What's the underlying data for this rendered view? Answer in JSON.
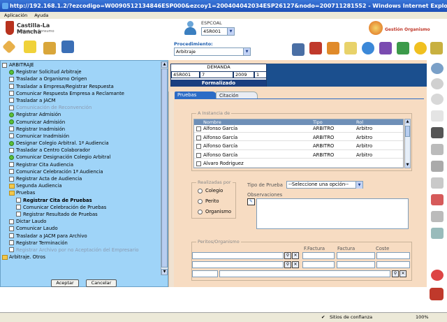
{
  "window": {
    "title": "http://192.168.1.2/?ezcodigo=W0090512134846ESP000&ezcoy1=200404042034ESP26127&nodo=200711281552 - Windows Internet Explorer"
  },
  "menubar": {
    "items": [
      "Aplicación",
      "Ayuda"
    ]
  },
  "header": {
    "logo_name": "Castilla-La Mancha",
    "logo_sub": "Instituto de Consumo",
    "espcoal_label": "ESPCOAL",
    "espcoal_value": "45R001",
    "gestion_label": "Gestión Organismo",
    "procedimiento_label": "Procedimiento:",
    "procedimiento_value": "Arbitraje"
  },
  "tree": {
    "items": [
      {
        "label": "ARBITRAJE",
        "icon": "minus-icon",
        "indent": 0
      },
      {
        "label": "Registrar Solicitud Arbitraje",
        "icon": "done-icon",
        "indent": 1
      },
      {
        "label": "Trasladar a Organismo Origen",
        "icon": "checkbox-icon",
        "indent": 1
      },
      {
        "label": "Trasladar a Empresa/Registrar Respuesta",
        "icon": "checkbox-icon",
        "indent": 1
      },
      {
        "label": "Comunicar Respuesta Empresa a Reclamante",
        "icon": "checkbox-icon",
        "indent": 1
      },
      {
        "label": "Trasladar a JACM",
        "icon": "checkbox-icon",
        "indent": 1
      },
      {
        "label": "Comunicación de Reconvención",
        "icon": "checkbox-icon",
        "indent": 1,
        "muted": true
      },
      {
        "label": "Registrar Admisión",
        "icon": "done-icon",
        "indent": 1
      },
      {
        "label": "Comunicar Admisión",
        "icon": "done-icon",
        "indent": 1
      },
      {
        "label": "Registrar Inadmisión",
        "icon": "checkbox-icon",
        "indent": 1
      },
      {
        "label": "Comunicar Inadmisión",
        "icon": "checkbox-icon",
        "indent": 1
      },
      {
        "label": "Designar Colegio Arbitral. 1ª Audiencia",
        "icon": "done-icon",
        "indent": 1
      },
      {
        "label": "Trasladar a Centro Colaborador",
        "icon": "checkbox-icon",
        "indent": 1
      },
      {
        "label": "Comunicar Designación Colegio Arbitral",
        "icon": "done-icon",
        "indent": 1
      },
      {
        "label": "Registrar Cita Audiencia",
        "icon": "checkbox-icon",
        "indent": 1
      },
      {
        "label": "Comunicar Celebración 1ª Audiencia",
        "icon": "checkbox-icon",
        "indent": 1
      },
      {
        "label": "Registrar Acta de Audiencia",
        "icon": "checkbox-icon",
        "indent": 1
      },
      {
        "label": "Segunda Audiencia",
        "icon": "folder-icon",
        "indent": 1
      },
      {
        "label": "Pruebas",
        "icon": "folder-icon",
        "indent": 1
      },
      {
        "label": "Registrar Cita de Pruebas",
        "icon": "checkbox-icon",
        "indent": 2,
        "bold": true
      },
      {
        "label": "Comunicar Celebración de Pruebas",
        "icon": "checkbox-icon",
        "indent": 2
      },
      {
        "label": "Registrar Resultado de Pruebas",
        "icon": "checkbox-icon",
        "indent": 2
      },
      {
        "label": "Dictar Laudo",
        "icon": "checkbox-icon",
        "indent": 1
      },
      {
        "label": "Comunicar Laudo",
        "icon": "checkbox-icon",
        "indent": 1
      },
      {
        "label": "Trasladar a JACM para Archivo",
        "icon": "checkbox-icon",
        "indent": 1
      },
      {
        "label": "Registrar Terminación",
        "icon": "checkbox-icon",
        "indent": 1
      },
      {
        "label": "Registrar Archivo por no Aceptación del Empresario",
        "icon": "checkbox-icon",
        "indent": 1,
        "muted": true
      },
      {
        "label": "Arbitraje. Otros",
        "icon": "folder-icon",
        "indent": 0
      }
    ],
    "accept_label": "Aceptar",
    "cancel_label": "Cancelar"
  },
  "demanda": {
    "title": "DEMANDA",
    "cells": [
      "45R001",
      "7",
      "2009",
      "1"
    ],
    "status": "Formalizado"
  },
  "tabs": [
    {
      "label": "Pruebas",
      "active": true
    },
    {
      "label": "Citación",
      "active": false
    }
  ],
  "instancia": {
    "legend": "A Instancia de",
    "columns": [
      "Nombre",
      "Tipo",
      "Rol"
    ],
    "rows": [
      [
        "Alfonso García",
        "ARBITRO",
        "Arbitro"
      ],
      [
        "Alfonso García",
        "ARBITRO",
        "Arbitro"
      ],
      [
        "Alfonso García",
        "ARBITRO",
        "Arbitro"
      ],
      [
        "Alfonso García",
        "ARBITRO",
        "Arbitro"
      ],
      [
        "Alvaro Rodriguez",
        "",
        ""
      ]
    ]
  },
  "realizadas": {
    "legend": "Realizadas por",
    "options": [
      "Colegio",
      "Perito",
      "Organismo"
    ]
  },
  "tipo_prueba": {
    "label": "Tipo de Prueba",
    "value": "--Seleccione una opción--"
  },
  "observaciones": {
    "label": "Observaciones"
  },
  "peritos": {
    "legend": "Peritos/Organismo",
    "columns": [
      "F.Factura",
      "Factura",
      "Coste"
    ]
  },
  "statusbar": {
    "zone": "Sitios de confianza",
    "zoom": "100%"
  },
  "colors": {
    "tree_bg": "#9fd4f8",
    "main_bg": "#f7dcc2",
    "tab_active": "#2c6cc6",
    "header_dark": "#1b3f80"
  }
}
